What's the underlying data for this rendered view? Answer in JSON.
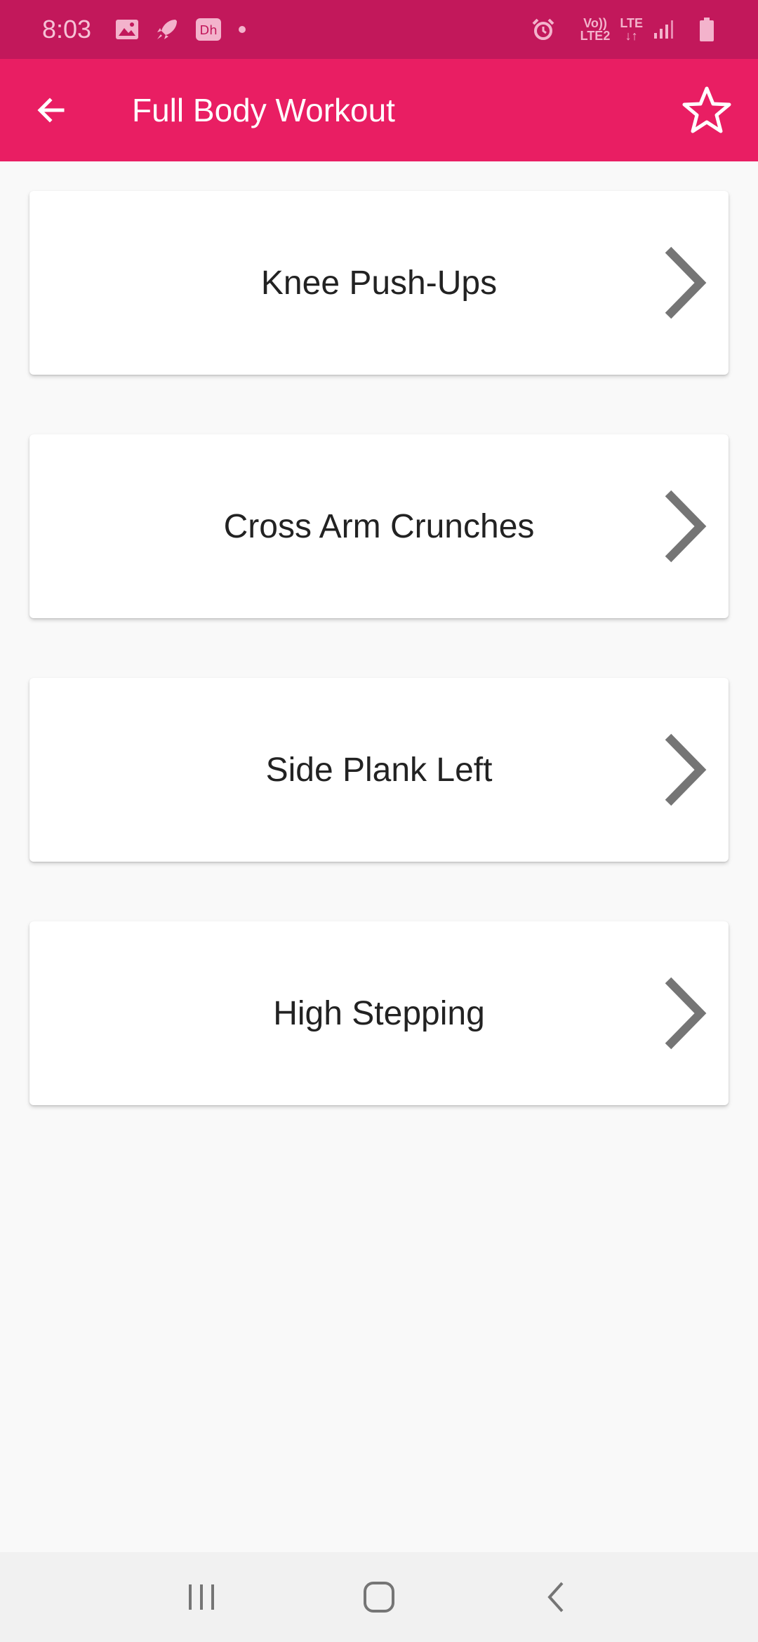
{
  "status_bar": {
    "time": "8:03",
    "volte_top": "Vo))",
    "volte_bottom": "LTE2",
    "network": "LTE",
    "icons": [
      "gallery-icon",
      "rocket-icon",
      "disney-hotstar-icon",
      "notification-dot-icon",
      "alarm-icon",
      "signal-icon",
      "battery-icon"
    ]
  },
  "app_bar": {
    "title": "Full Body Workout",
    "back_icon": "arrow-left-icon",
    "favorite_icon": "star-outline-icon"
  },
  "exercises": [
    {
      "label": "Knee Push-Ups"
    },
    {
      "label": "Cross Arm Crunches"
    },
    {
      "label": "Side Plank Left"
    },
    {
      "label": "High Stepping"
    }
  ],
  "nav_bar": {
    "icons": [
      "recent-apps-icon",
      "home-icon",
      "back-icon"
    ]
  },
  "colors": {
    "status_bar": "#c2185b",
    "app_bar": "#e91e63",
    "background": "#f9f9f9",
    "chevron": "#757575"
  }
}
